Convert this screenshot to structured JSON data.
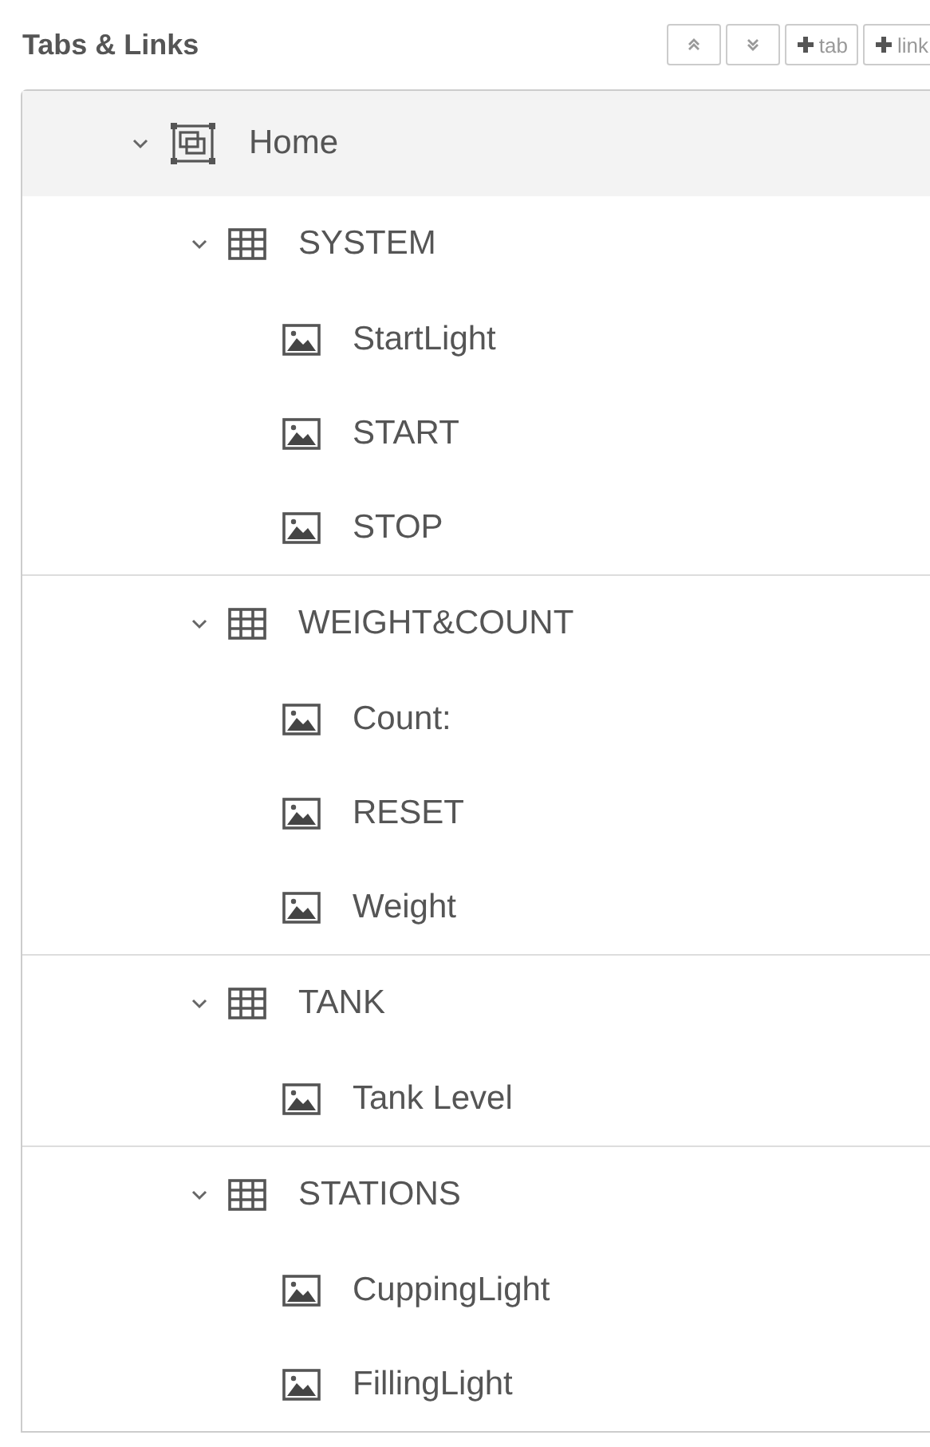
{
  "header": {
    "title": "Tabs & Links",
    "buttons": [
      {
        "kind": "collapse-all"
      },
      {
        "kind": "expand-all"
      },
      {
        "kind": "add",
        "label": "tab"
      },
      {
        "kind": "add",
        "label": "link"
      }
    ]
  },
  "tabs": [
    {
      "label": "Home",
      "expanded": true,
      "selected": true,
      "groups": [
        {
          "label": "SYSTEM",
          "expanded": true,
          "widgets": [
            {
              "label": "StartLight"
            },
            {
              "label": "START"
            },
            {
              "label": "STOP"
            }
          ]
        },
        {
          "label": "WEIGHT&COUNT",
          "expanded": true,
          "widgets": [
            {
              "label": "Count:"
            },
            {
              "label": "RESET"
            },
            {
              "label": "Weight"
            }
          ]
        },
        {
          "label": "TANK",
          "expanded": true,
          "widgets": [
            {
              "label": "Tank Level"
            }
          ]
        },
        {
          "label": "STATIONS",
          "expanded": true,
          "widgets": [
            {
              "label": "CuppingLight"
            },
            {
              "label": "FillingLight"
            }
          ]
        }
      ]
    }
  ]
}
